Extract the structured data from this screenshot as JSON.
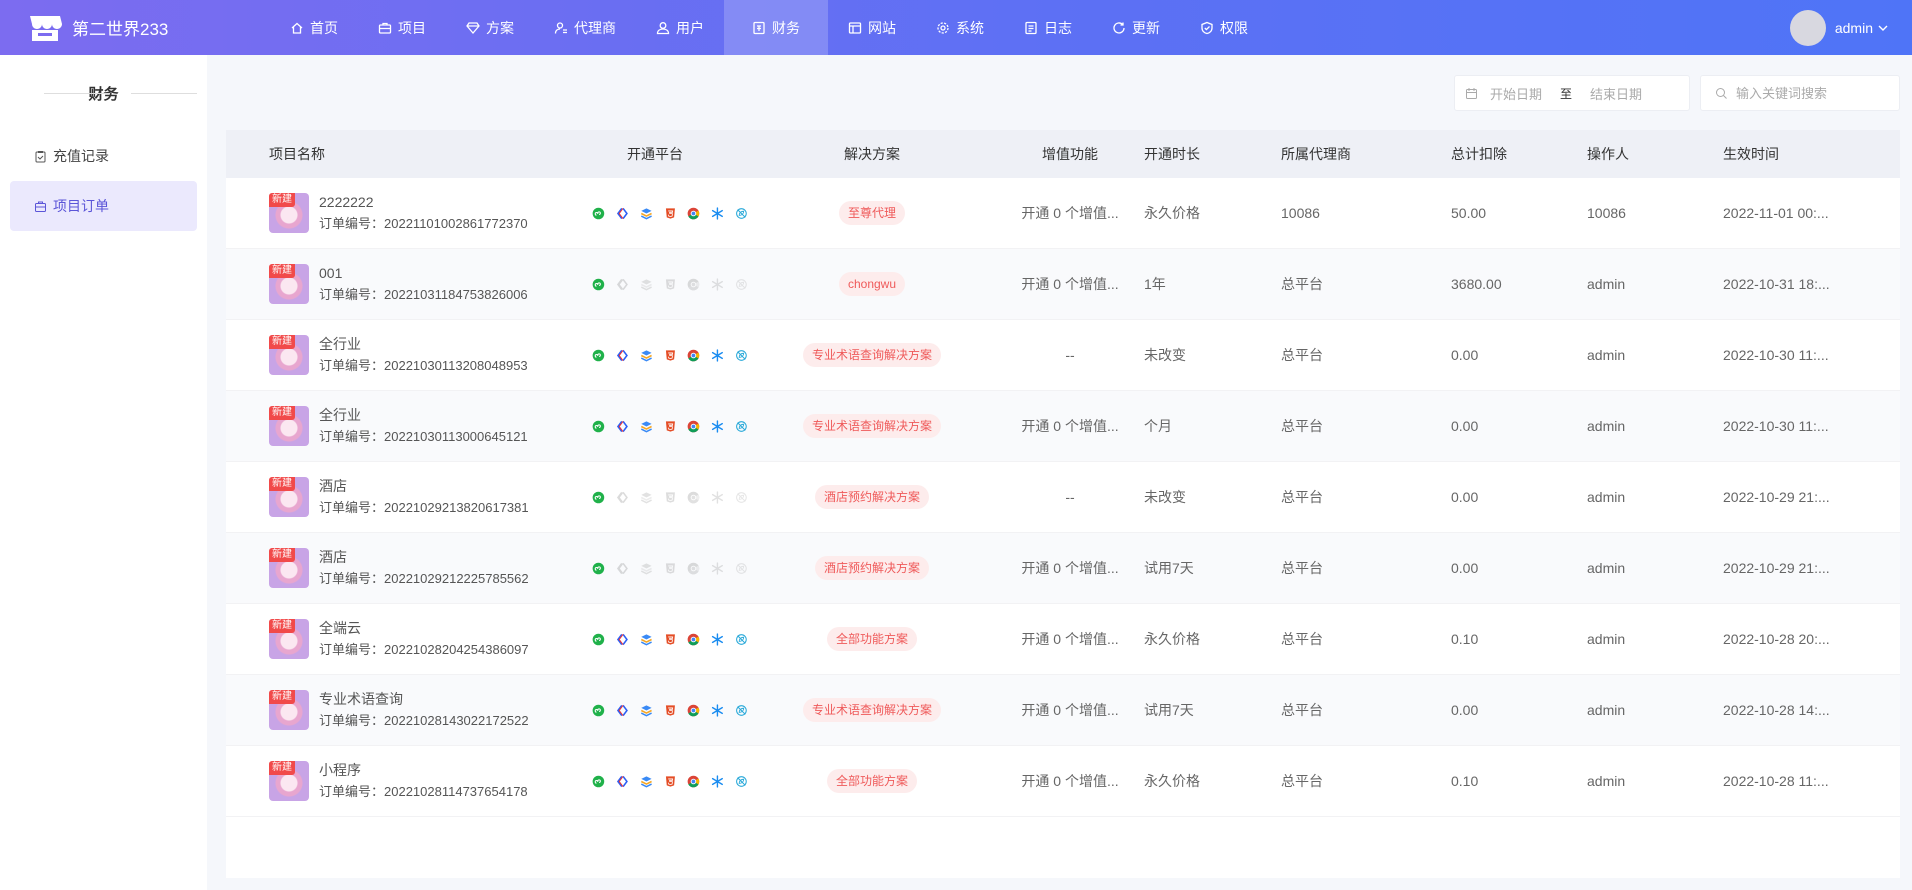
{
  "brand": {
    "name": "第二世界233"
  },
  "nav": [
    {
      "label": "首页",
      "icon": "home-icon"
    },
    {
      "label": "项目",
      "icon": "briefcase-icon"
    },
    {
      "label": "方案",
      "icon": "diamond-icon"
    },
    {
      "label": "代理商",
      "icon": "agent-icon"
    },
    {
      "label": "用户",
      "icon": "user-icon"
    },
    {
      "label": "财务",
      "icon": "finance-icon",
      "active": true
    },
    {
      "label": "网站",
      "icon": "website-icon"
    },
    {
      "label": "系统",
      "icon": "gear-icon"
    },
    {
      "label": "日志",
      "icon": "log-icon"
    },
    {
      "label": "更新",
      "icon": "refresh-icon"
    },
    {
      "label": "权限",
      "icon": "shield-icon"
    }
  ],
  "user": {
    "name": "admin"
  },
  "sidebar": {
    "title": "财务",
    "items": [
      {
        "label": "充值记录",
        "active": false
      },
      {
        "label": "项目订单",
        "active": true
      }
    ]
  },
  "filters": {
    "start_placeholder": "开始日期",
    "range_separator": "至",
    "end_placeholder": "结束日期",
    "search_placeholder": "输入关键词搜索"
  },
  "table": {
    "headers": [
      "项目名称",
      "开通平台",
      "解决方案",
      "增值功能",
      "开通时长",
      "所属代理商",
      "总计扣除",
      "操作人",
      "生效时间"
    ],
    "badge": "新建",
    "order_prefix": "订单编号：",
    "rows": [
      {
        "name": "2222222",
        "order": "20221101002861772370",
        "platforms": "all",
        "solution": "至尊代理",
        "addon": "开通 0 个增值...",
        "duration": "永久价格",
        "agent": "10086",
        "deduction": "50.00",
        "operator": "10086",
        "time": "2022-11-01 00:..."
      },
      {
        "name": "001",
        "order": "20221031184753826006",
        "platforms": "one",
        "solution": "chongwu",
        "addon": "开通 0 个增值...",
        "duration": "1年",
        "agent": "总平台",
        "deduction": "3680.00",
        "operator": "admin",
        "time": "2022-10-31 18:..."
      },
      {
        "name": "全行业",
        "order": "20221030113208048953",
        "platforms": "all",
        "solution": "专业术语查询解决方案",
        "addon": "--",
        "duration": "未改变",
        "agent": "总平台",
        "deduction": "0.00",
        "operator": "admin",
        "time": "2022-10-30 11:..."
      },
      {
        "name": "全行业",
        "order": "20221030113000645121",
        "platforms": "all",
        "solution": "专业术语查询解决方案",
        "addon": "开通 0 个增值...",
        "duration": "个月",
        "agent": "总平台",
        "deduction": "0.00",
        "operator": "admin",
        "time": "2022-10-30 11:..."
      },
      {
        "name": "酒店",
        "order": "20221029213820617381",
        "platforms": "one",
        "solution": "酒店预约解决方案",
        "addon": "--",
        "duration": "未改变",
        "agent": "总平台",
        "deduction": "0.00",
        "operator": "admin",
        "time": "2022-10-29 21:..."
      },
      {
        "name": "酒店",
        "order": "20221029212225785562",
        "platforms": "one",
        "solution": "酒店预约解决方案",
        "addon": "开通 0 个增值...",
        "duration": "试用7天",
        "agent": "总平台",
        "deduction": "0.00",
        "operator": "admin",
        "time": "2022-10-29 21:..."
      },
      {
        "name": "全端云",
        "order": "20221028204254386097",
        "platforms": "all",
        "solution": "全部功能方案",
        "addon": "开通 0 个增值...",
        "duration": "永久价格",
        "agent": "总平台",
        "deduction": "0.10",
        "operator": "admin",
        "time": "2022-10-28 20:..."
      },
      {
        "name": "专业术语查询",
        "order": "20221028143022172522",
        "platforms": "all",
        "solution": "专业术语查询解决方案",
        "addon": "开通 0 个增值...",
        "duration": "试用7天",
        "agent": "总平台",
        "deduction": "0.00",
        "operator": "admin",
        "time": "2022-10-28 14:..."
      },
      {
        "name": "小程序",
        "order": "20221028114737654178",
        "platforms": "all",
        "solution": "全部功能方案",
        "addon": "开通 0 个增值...",
        "duration": "永久价格",
        "agent": "总平台",
        "deduction": "0.10",
        "operator": "admin",
        "time": "2022-10-28 11:..."
      }
    ]
  },
  "colors": {
    "header_start": "#7c6cf0",
    "header_end": "#4f74f7",
    "accent": "#5b55d8",
    "tag_bg": "#fdecec",
    "tag_text": "#ef5a5a"
  }
}
